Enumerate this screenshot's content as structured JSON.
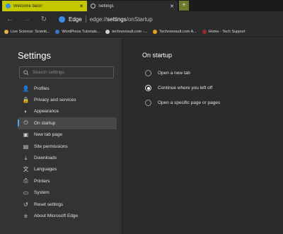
{
  "tabs": [
    {
      "title": "Welcome back!",
      "close": "✕"
    },
    {
      "title": "Settings",
      "close": "✕"
    }
  ],
  "new_tab_label": "+",
  "toolbar": {
    "back": "←",
    "forward": "→",
    "refresh": "↻",
    "brand": "Edge",
    "url_prefix": "edge://",
    "url_host": "settings",
    "url_path": "/onStartup"
  },
  "bookmarks": [
    {
      "label": "Live Science: Scienti...",
      "color": "#e3b04a"
    },
    {
      "label": "WordPress Tutorials...",
      "color": "#3a74c4"
    },
    {
      "label": "technoresult.com -...",
      "color": "#d0d0d0"
    },
    {
      "label": "Technoresult.com A...",
      "color": "#e8a020"
    },
    {
      "label": "Home - Tech Support",
      "color": "#9a2a2a"
    }
  ],
  "sidebar": {
    "title": "Settings",
    "search_placeholder": "Search settings",
    "items": [
      {
        "label": "Profiles",
        "icon": "👤",
        "selected": false
      },
      {
        "label": "Privacy and services",
        "icon": "🔒",
        "selected": false
      },
      {
        "label": "Appearance",
        "icon": "◐",
        "selected": false
      },
      {
        "label": "On startup",
        "icon": "⏻",
        "selected": true
      },
      {
        "label": "New tab page",
        "icon": "▣",
        "selected": false
      },
      {
        "label": "Site permissions",
        "icon": "▤",
        "selected": false
      },
      {
        "label": "Downloads",
        "icon": "⤓",
        "selected": false
      },
      {
        "label": "Languages",
        "icon": "文",
        "selected": false
      },
      {
        "label": "Printers",
        "icon": "⎙",
        "selected": false
      },
      {
        "label": "System",
        "icon": "▭",
        "selected": false
      },
      {
        "label": "Reset settings",
        "icon": "↺",
        "selected": false
      },
      {
        "label": "About Microsoft Edge",
        "icon": "e",
        "selected": false
      }
    ]
  },
  "main": {
    "title": "On startup",
    "options": [
      {
        "label": "Open a new tab",
        "checked": false
      },
      {
        "label": "Continue where you left off",
        "checked": true
      },
      {
        "label": "Open a specific page or pages",
        "checked": false
      }
    ]
  },
  "colors": {
    "accent": "#4ea4ef",
    "tab_inactive": "#c4c800"
  }
}
